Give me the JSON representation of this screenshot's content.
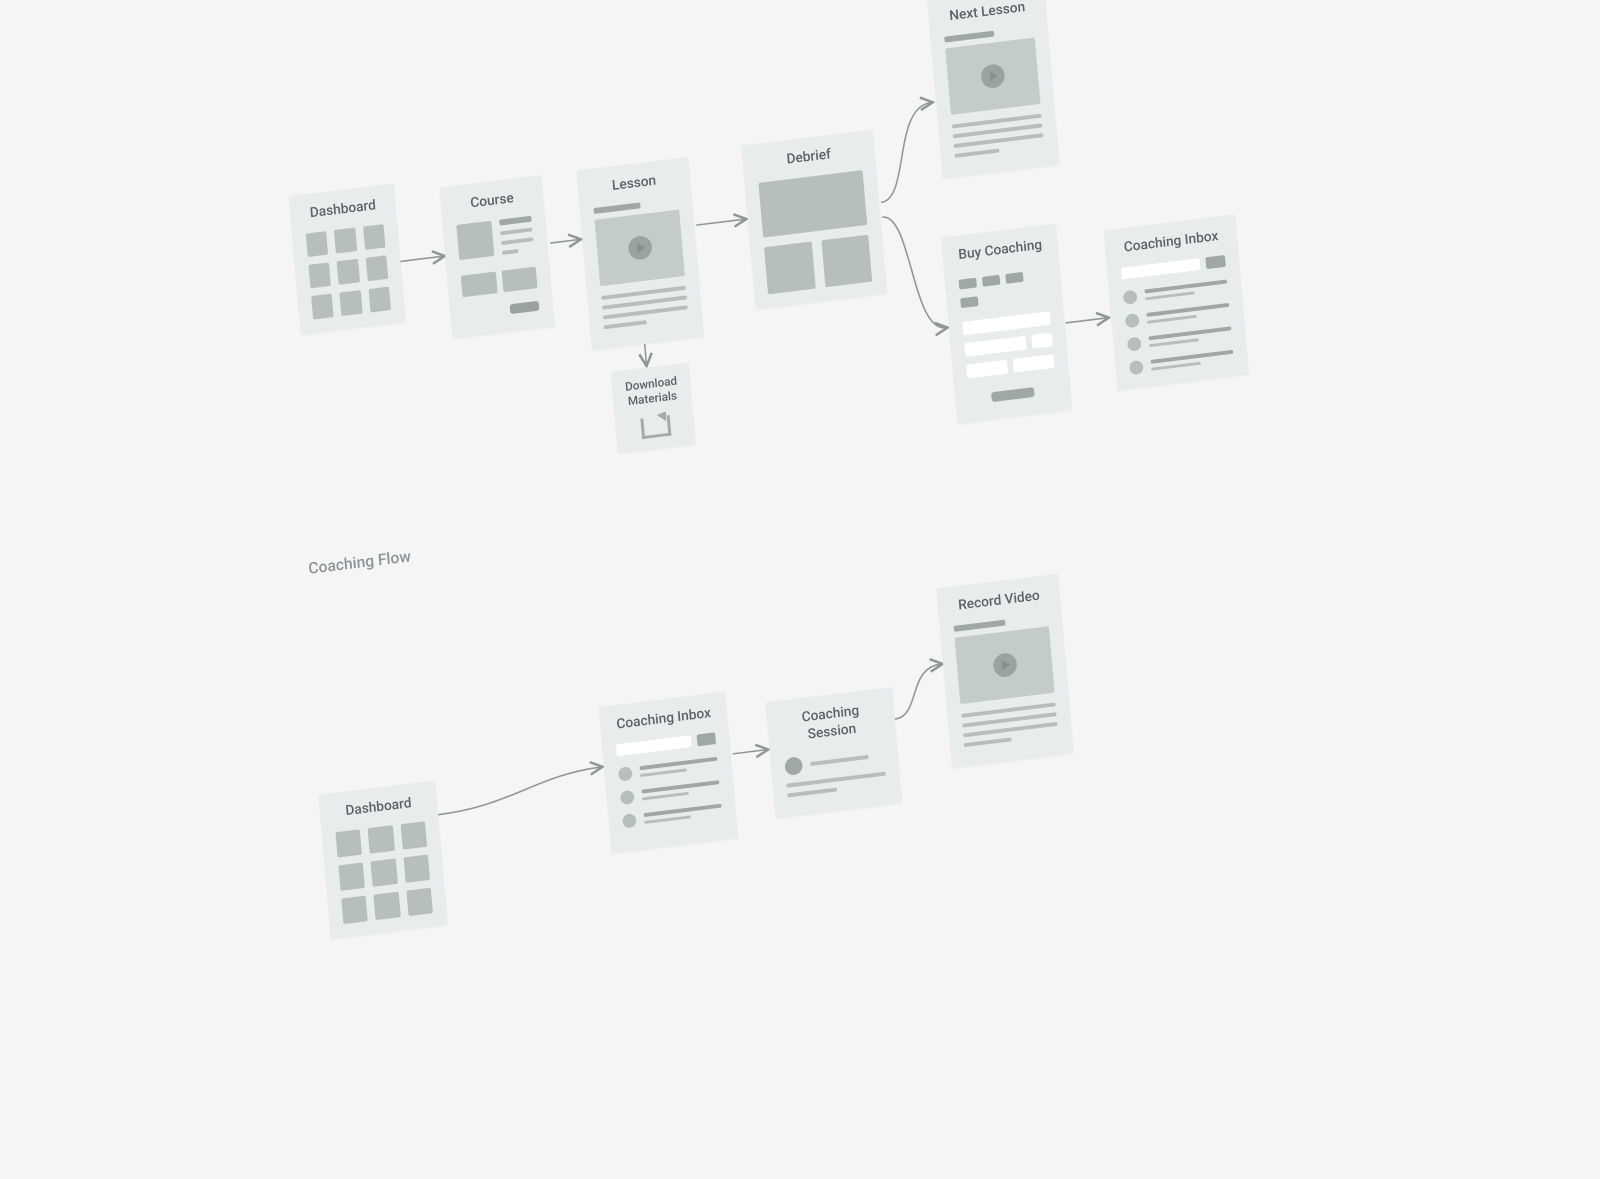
{
  "cards": {
    "dashboard1": "Dashboard",
    "course": "Course",
    "lesson": "Lesson",
    "debrief": "Debrief",
    "next_lesson": "Next Lesson",
    "download_materials": "Download\nMaterials",
    "buy_coaching": "Buy Coaching",
    "coaching_inbox1": "Coaching Inbox",
    "dashboard2": "Dashboard",
    "coaching_inbox2": "Coaching Inbox",
    "coaching_session": "Coaching Session",
    "record_video": "Record Video"
  },
  "sections": {
    "coaching_flow": "Coaching Flow"
  },
  "colors": {
    "card_bg": "#e9ecec",
    "placeholder": "#b7bebe",
    "placeholder_dark": "#a0a7a7",
    "text": "#5b6366",
    "page_bg": "#f5f5f5",
    "connector": "#8f9797"
  }
}
